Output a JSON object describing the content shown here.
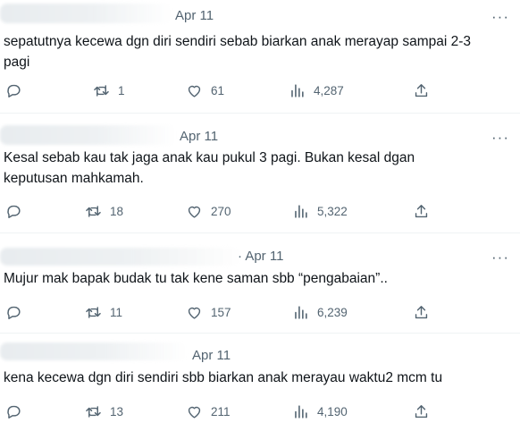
{
  "replies": [
    {
      "date": "Apr 11",
      "text": "sepatutnya kecewa dgn diri sendiri sebab biarkan anak merayap sampai 2-3 pagi",
      "retweets": "1",
      "likes": "61",
      "views": "4,287"
    },
    {
      "date": "Apr 11",
      "text": "Kesal sebab kau tak jaga anak kau pukul 3 pagi. Bukan kesal dgan keputusan mahkamah.",
      "retweets": "18",
      "likes": "270",
      "views": "5,322"
    },
    {
      "date": "· Apr 11",
      "text": "Mujur mak bapak budak tu tak kene saman sbb “pengabaian”..",
      "retweets": "11",
      "likes": "157",
      "views": "6,239"
    },
    {
      "date": "Apr 11",
      "text": "kena kecewa dgn diri sendiri sbb biarkan anak merayau waktu2 mcm tu",
      "retweets": "13",
      "likes": "211",
      "views": "4,190"
    }
  ],
  "more_glyph": "···"
}
